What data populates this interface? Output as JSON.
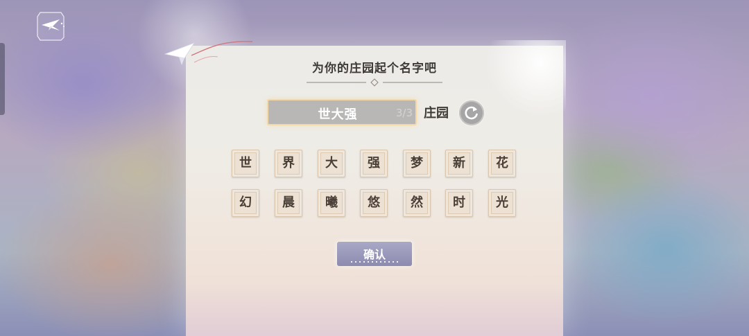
{
  "dialog": {
    "title": "为你的庄园起个名字吧",
    "name_value": "世大强",
    "char_count": "3/3",
    "suffix": "庄园",
    "confirm_label": "确认"
  },
  "characters": {
    "row1": [
      "世",
      "界",
      "大",
      "强",
      "梦",
      "新",
      "花"
    ],
    "row2": [
      "幻",
      "晨",
      "曦",
      "悠",
      "然",
      "时",
      "光"
    ]
  },
  "icons": {
    "back": "paper-plane-back-icon",
    "refresh": "refresh-icon",
    "decoration": "paper-plane-icon"
  },
  "colors": {
    "panel": "#efece6",
    "input_border": "#f3d9a8",
    "tile": "#ece1d3",
    "confirm": "#9a99bc",
    "text": "#3e3a36"
  }
}
